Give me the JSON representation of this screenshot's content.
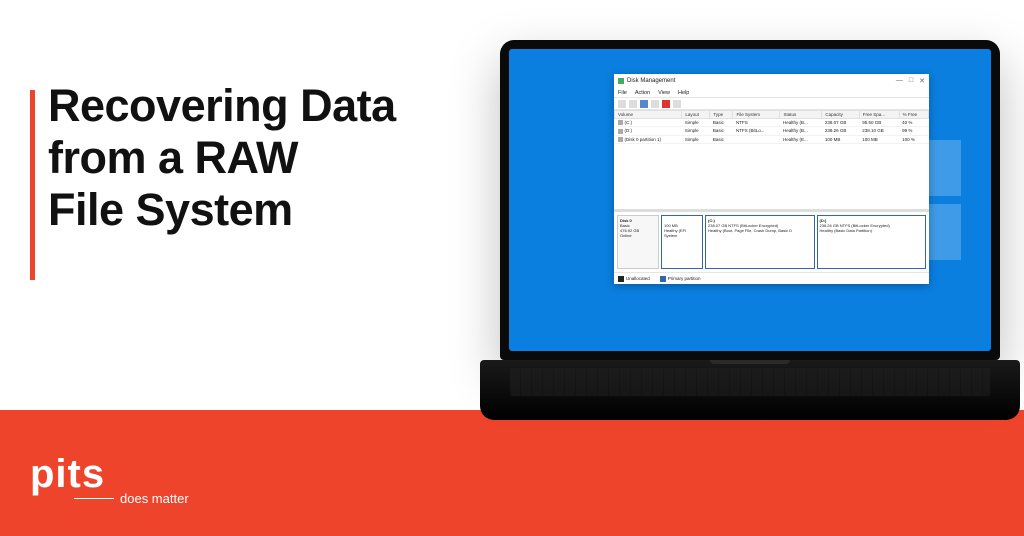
{
  "headline": "Recovering Data\nfrom a RAW\nFile System",
  "logo": {
    "main": "pits",
    "sub": "does matter"
  },
  "dm": {
    "title": "Disk Management",
    "menu": [
      "File",
      "Action",
      "View",
      "Help"
    ],
    "columns": [
      "Volume",
      "Layout",
      "Type",
      "File System",
      "Status",
      "Capacity",
      "Free Spa...",
      "% Free"
    ],
    "rows": [
      {
        "vol": "(C:)",
        "layout": "Simple",
        "type": "Basic",
        "fs": "NTFS",
        "status": "Healthy (B...",
        "cap": "238.07 GB",
        "free": "95.50 GB",
        "pct": "40 %"
      },
      {
        "vol": "(D:)",
        "layout": "Simple",
        "type": "Basic",
        "fs": "NTFS (BitLo...",
        "status": "Healthy (B...",
        "cap": "238.26 GB",
        "free": "238.10 GB",
        "pct": "99 %"
      },
      {
        "vol": "(Disk 0 partition 1)",
        "layout": "Simple",
        "type": "Basic",
        "fs": "",
        "status": "Healthy (E...",
        "cap": "100 MB",
        "free": "100 MB",
        "pct": "100 %"
      }
    ],
    "disk": {
      "name": "Disk 0",
      "sub": "Basic",
      "size": "476.92 GB",
      "state": "Online",
      "parts": [
        {
          "hdr": "",
          "l1": "100 MB",
          "l2": "Healthy (EFI System"
        },
        {
          "hdr": "(C:)",
          "l1": "238.07 GB NTFS (BitLocker Encrypted)",
          "l2": "Healthy (Boot, Page File, Crash Dump, Basic D"
        },
        {
          "hdr": "(D:)",
          "l1": "238.26 GB NTFS (BitLocker Encrypted)",
          "l2": "Healthy (Basic Data Partition)"
        }
      ]
    },
    "legend": [
      "Unallocated",
      "Primary partition"
    ]
  }
}
